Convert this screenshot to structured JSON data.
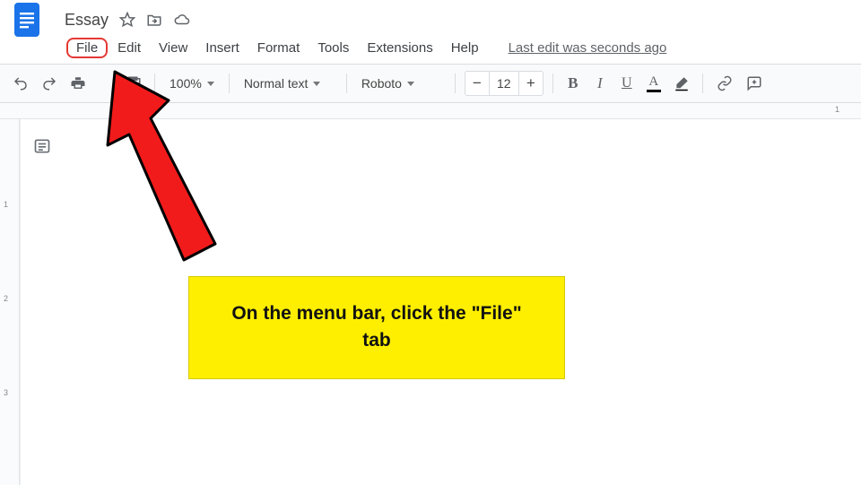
{
  "header": {
    "doc_title": "Essay"
  },
  "menu": {
    "items": [
      "File",
      "Edit",
      "View",
      "Insert",
      "Format",
      "Tools",
      "Extensions",
      "Help"
    ],
    "highlighted_index": 0,
    "last_edit": "Last edit was seconds ago"
  },
  "toolbar": {
    "zoom": "100%",
    "paragraph_style": "Normal text",
    "font": "Roboto",
    "font_size": "12"
  },
  "ruler": {
    "h_marks": [
      "1"
    ],
    "v_marks": [
      "1",
      "2",
      "3"
    ]
  },
  "annotation": {
    "text": "On the menu bar, click the \"File\" tab"
  }
}
